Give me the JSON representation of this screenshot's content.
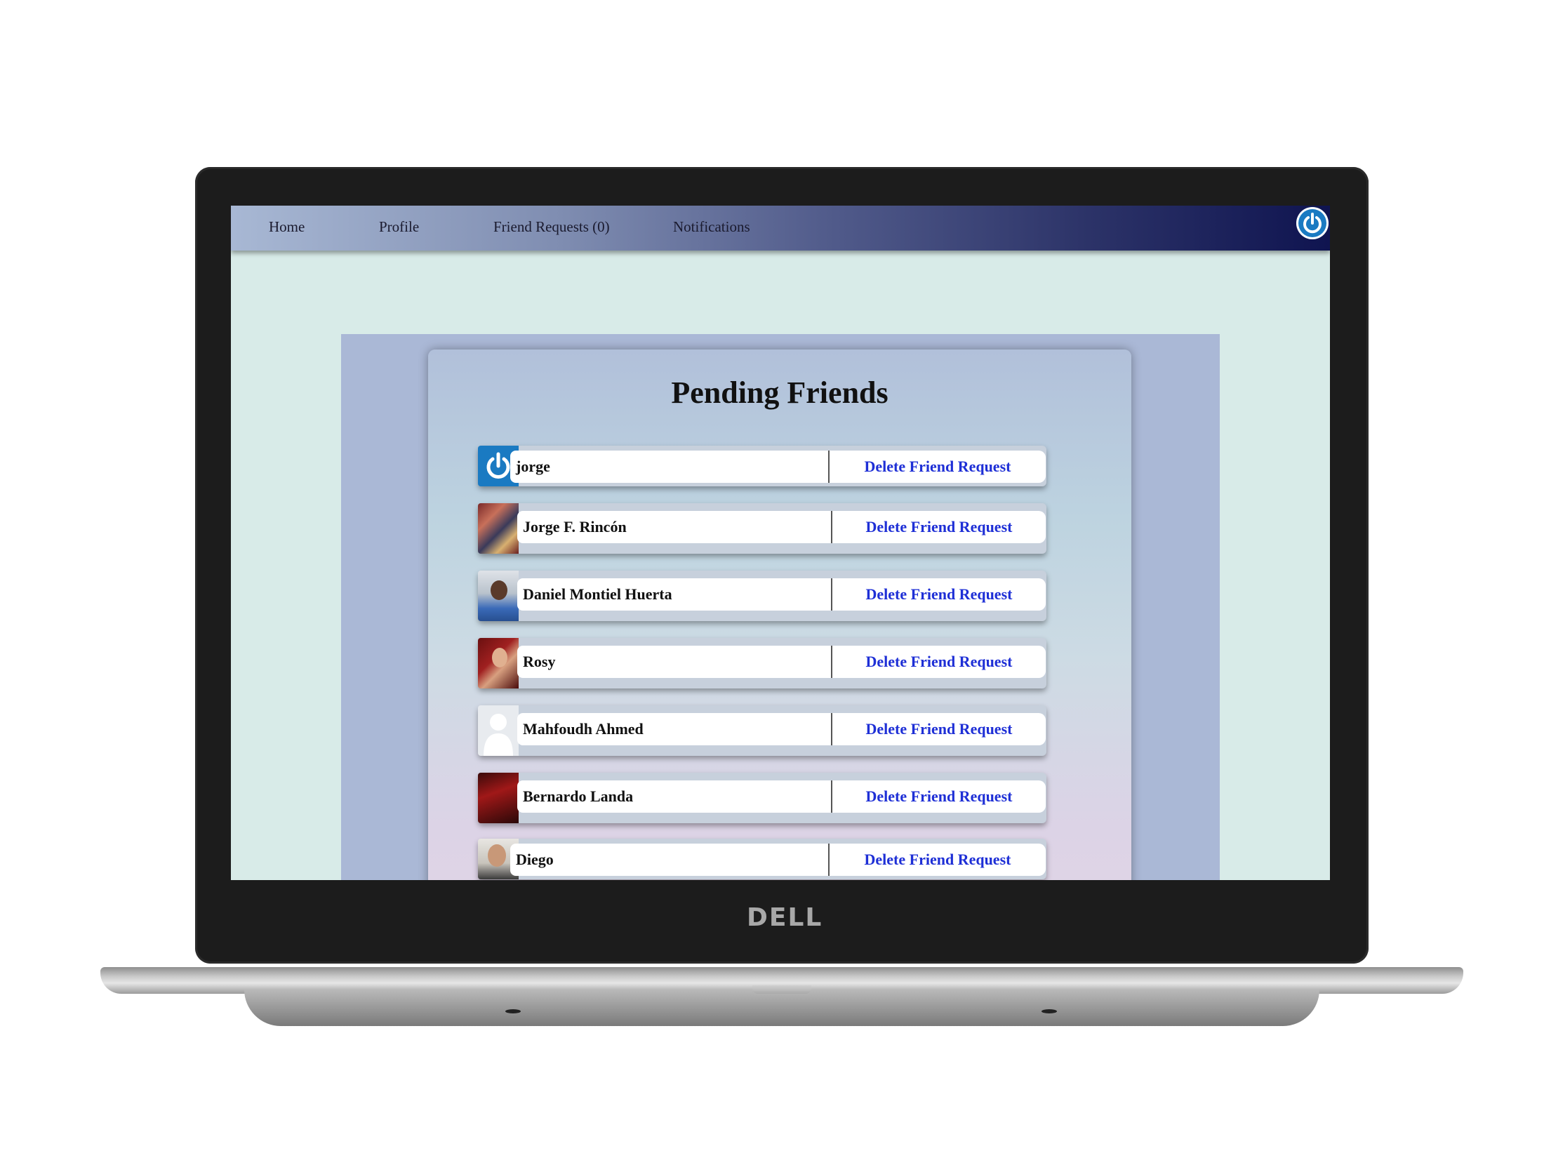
{
  "device": {
    "brand": "DELL"
  },
  "nav": {
    "items": [
      {
        "label": "Home"
      },
      {
        "label": "Profile"
      },
      {
        "label": "Friend Requests (0)"
      },
      {
        "label": "Notifications"
      }
    ],
    "logout_icon": "power-icon"
  },
  "page": {
    "title": "Pending Friends",
    "friends": [
      {
        "name": "jorge",
        "avatar": "power-logo",
        "action": "Delete Friend Request"
      },
      {
        "name": "Jorge F. Rincón",
        "avatar": "photo-collage",
        "action": "Delete Friend Request"
      },
      {
        "name": "Daniel Montiel Huerta",
        "avatar": "photo-person",
        "action": "Delete Friend Request"
      },
      {
        "name": "Rosy",
        "avatar": "photo-person",
        "action": "Delete Friend Request"
      },
      {
        "name": "Mahfoudh Ahmed",
        "avatar": "default-silhouette",
        "action": "Delete Friend Request"
      },
      {
        "name": "Bernardo Landa",
        "avatar": "photo-dark",
        "action": "Delete Friend Request"
      },
      {
        "name": "Diego",
        "avatar": "photo-person",
        "action": "Delete Friend Request"
      }
    ]
  },
  "colors": {
    "accent_blue": "#1a7ac2",
    "link": "#1e2fd6",
    "screen_bg": "#d8ebe8",
    "nav_dark": "#0f1450"
  }
}
